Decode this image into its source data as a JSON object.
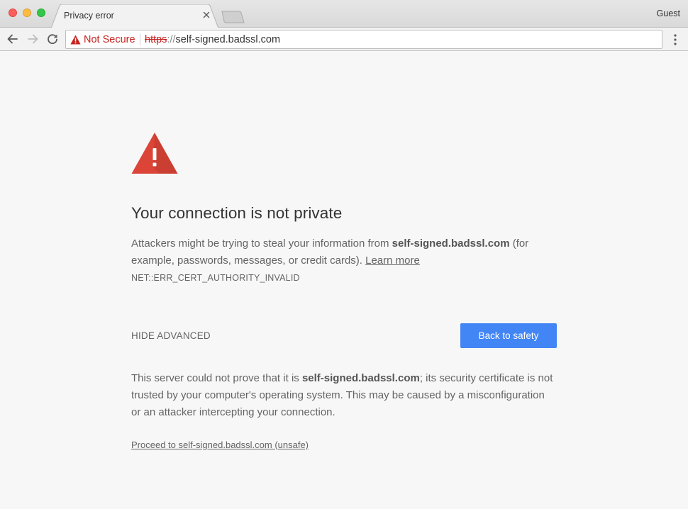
{
  "browser": {
    "tab_title": "Privacy error",
    "profile_label": "Guest",
    "omnibox": {
      "security_label": "Not Secure",
      "url_scheme": "https",
      "url_separator": "://",
      "url_host": "self-signed.badssl.com"
    },
    "icons": {
      "back": "arrow-back-icon",
      "forward": "arrow-forward-icon",
      "reload": "reload-icon",
      "warning": "warning-triangle-icon",
      "menu": "vertical-dots-menu-icon",
      "close_tab": "close-icon"
    }
  },
  "interstitial": {
    "heading": "Your connection is not private",
    "intro_prefix": "Attackers might be trying to steal your information from ",
    "intro_host": "self-signed.badssl.com",
    "intro_suffix": " (for example, passwords, messages, or credit cards). ",
    "learn_more": "Learn more",
    "error_code": "NET::ERR_CERT_AUTHORITY_INVALID",
    "hide_advanced": "HIDE ADVANCED",
    "back_button": "Back to safety",
    "details_prefix": "This server could not prove that it is ",
    "details_host": "self-signed.badssl.com",
    "details_suffix": "; its security certificate is not trusted by your computer's operating system. This may be caused by a misconfiguration or an attacker intercepting your connection.",
    "proceed_link": "Proceed to self-signed.badssl.com (unsafe)"
  },
  "colors": {
    "danger_red": "#c5221f",
    "alert_icon_red": "#db4437",
    "primary_blue": "#4285f4",
    "page_background": "#f7f7f7",
    "body_text": "#646464"
  }
}
